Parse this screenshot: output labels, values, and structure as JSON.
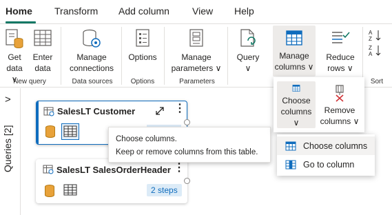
{
  "tabs": [
    "Home",
    "Transform",
    "Add column",
    "View",
    "Help"
  ],
  "ribbon": {
    "get_data": [
      "Get",
      "data ∨"
    ],
    "enter_data": [
      "Enter",
      "data"
    ],
    "manage_connections": [
      "Manage",
      "connections"
    ],
    "options": "Options",
    "manage_parameters": [
      "Manage",
      "parameters ∨"
    ],
    "query": [
      "Query",
      "∨"
    ],
    "manage_columns": [
      "Manage",
      "columns ∨"
    ],
    "reduce_rows": [
      "Reduce",
      "rows ∨"
    ],
    "groups": {
      "new_query": "New query",
      "data_sources": "Data sources",
      "options": "Options",
      "parameters": "Parameters",
      "sort": "Sort"
    }
  },
  "flyout": {
    "choose_columns": [
      "Choose",
      "columns ∨"
    ],
    "remove_columns": [
      "Remove",
      "columns ∨"
    ]
  },
  "sidebar": {
    "label": "Queries [2]",
    "toggle": ">"
  },
  "queries": [
    {
      "name": "SalesLT Customer"
    },
    {
      "name": "SalesLT SalesOrderHeader",
      "steps": "2 steps"
    }
  ],
  "tooltip": {
    "title": "Choose columns.",
    "description": "Keep or remove columns from this table."
  },
  "menu": {
    "items": [
      "Choose columns",
      "Go to column"
    ]
  },
  "colors": {
    "accent": "#117865",
    "selection": "#0f6cbd",
    "db_icon": "#e8a23a"
  }
}
